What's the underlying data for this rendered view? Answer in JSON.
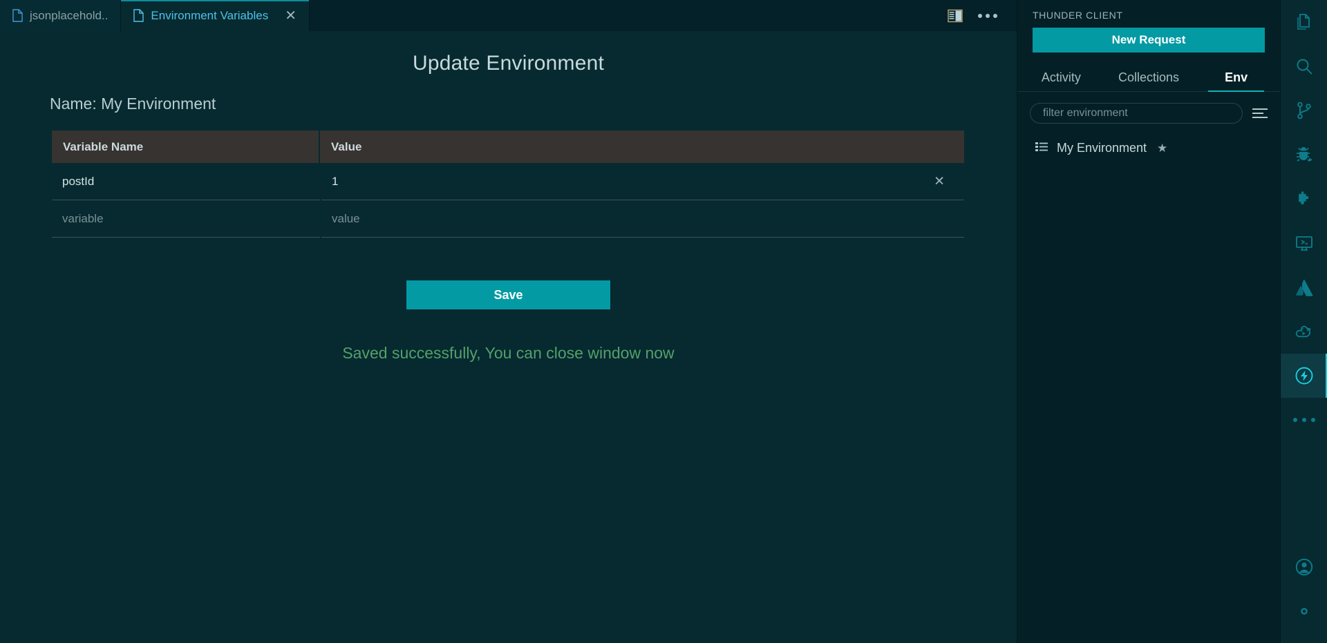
{
  "editor": {
    "tabs": [
      {
        "label": "jsonplacehold..",
        "icon": "file-icon",
        "active": false,
        "closable": false
      },
      {
        "label": "Environment Variables",
        "icon": "file-icon",
        "active": true,
        "closable": true
      }
    ],
    "tabbar_actions": [
      {
        "name": "split-editor-icon",
        "label": ""
      },
      {
        "name": "more-actions-icon",
        "label": ""
      }
    ]
  },
  "main": {
    "title": "Update Environment",
    "name_line": "Name: My Environment",
    "table": {
      "headers": [
        "Variable Name",
        "Value"
      ],
      "rows": [
        {
          "variable": "postId",
          "value": "1",
          "deletable": true
        },
        {
          "variable": "",
          "value": "",
          "variable_placeholder": "variable",
          "value_placeholder": "value",
          "deletable": false
        }
      ]
    },
    "save_label": "Save",
    "status_message": "Saved successfully, You can close window now",
    "status_color": "#55a06a"
  },
  "panel": {
    "title": "THUNDER CLIENT",
    "new_request_label": "New Request",
    "tabs": [
      {
        "label": "Activity",
        "active": false
      },
      {
        "label": "Collections",
        "active": false
      },
      {
        "label": "Env",
        "active": true
      }
    ],
    "filter_placeholder": "filter environment",
    "filter_value": "",
    "menu_icon": "hamburger-menu-icon",
    "environments": [
      {
        "name": "My Environment",
        "starred": true,
        "star_glyph": "★"
      }
    ]
  },
  "activity_bar": {
    "items": [
      {
        "name": "explorer-icon",
        "active": false
      },
      {
        "name": "search-icon",
        "active": false
      },
      {
        "name": "source-control-icon",
        "active": false
      },
      {
        "name": "run-and-debug-icon",
        "active": false
      },
      {
        "name": "extensions-icon",
        "active": false
      },
      {
        "name": "remote-explorer-icon",
        "active": false
      },
      {
        "name": "atlassian-icon",
        "active": false
      },
      {
        "name": "rubber-duck-icon",
        "active": false
      },
      {
        "name": "thunder-client-icon",
        "active": true
      },
      {
        "name": "more-views-icon",
        "active": false
      }
    ],
    "bottom_items": [
      {
        "name": "accounts-icon",
        "active": false
      },
      {
        "name": "settings-gear-icon",
        "active": false
      }
    ]
  },
  "theme": {
    "accent": "#049aa4",
    "tab_active_text": "#4fc1e9",
    "editor_bg": "#062a30",
    "panel_bg": "#042026",
    "table_header_bg": "#373331"
  }
}
